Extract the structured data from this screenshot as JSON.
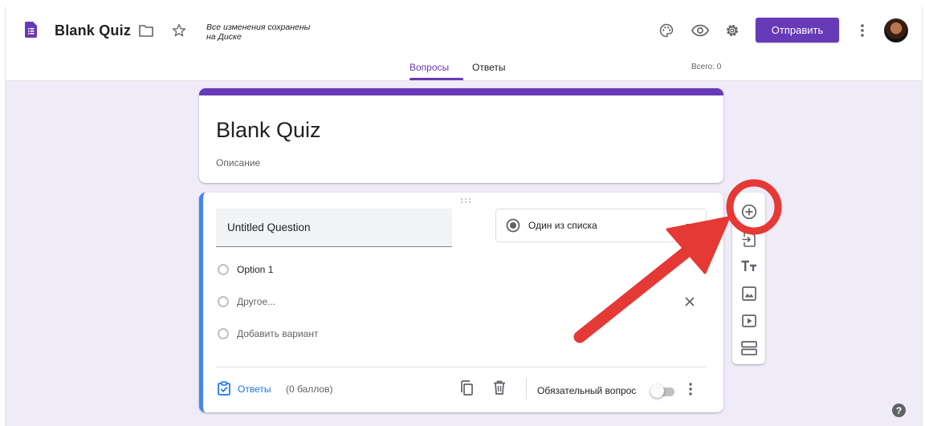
{
  "header": {
    "title": "Blank Quiz",
    "save_status_line1": "Все изменения сохранены",
    "save_status_line2": "на Диске",
    "send_label": "Отправить"
  },
  "tabs": [
    {
      "label": "Вопросы",
      "active": true
    },
    {
      "label": "Ответы",
      "active": false
    }
  ],
  "total_label": "Всего: 0",
  "form": {
    "title": "Blank Quiz",
    "description_placeholder": "Описание"
  },
  "question": {
    "title": "Untitled Question",
    "type": "Один из списка",
    "options": [
      {
        "label": "Option 1"
      },
      {
        "label": "Другое..."
      },
      {
        "label": "Добавить вариант"
      }
    ],
    "answers_label": "Ответы",
    "points_label": "(0 баллов)",
    "required_label": "Обязательный вопрос",
    "required": false
  },
  "side_toolbar": [
    "add-question-icon",
    "import-questions-icon",
    "title-text-icon",
    "image-icon",
    "video-icon",
    "section-icon"
  ],
  "colors": {
    "accent": "#673ab7",
    "question_border": "#4285f4",
    "background": "#f0ebf8",
    "annotation": "#e53935"
  },
  "help_label": "?"
}
